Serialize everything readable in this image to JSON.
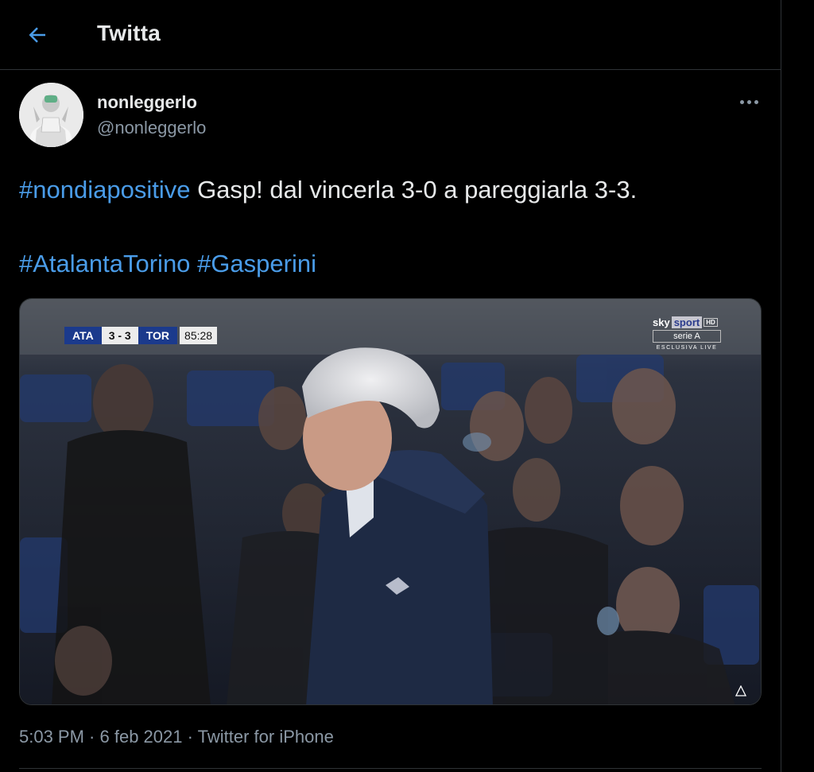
{
  "header": {
    "title": "Twitta",
    "back_icon": "arrow-left-icon"
  },
  "author": {
    "display_name": "nonleggerlo",
    "handle": "@nonleggerlo"
  },
  "tweet": {
    "line1_hashtag": "#nondiapositive",
    "line1_text": " Gasp! dal vincerla 3-0 a pareggiarla 3-3.",
    "line2_hashtag1": "#AtalantaTorino",
    "line2_space": " ",
    "line2_hashtag2": "#Gasperini"
  },
  "media": {
    "scorebug": {
      "home": "ATA",
      "score": "3 - 3",
      "away": "TOR",
      "clock": "85:28"
    },
    "broadcaster": {
      "brand_sky": "sky",
      "brand_sport": "sport",
      "brand_hd": "HD",
      "competition": "serie A",
      "live_label": "ESCLUSIVA LIVE"
    }
  },
  "meta": {
    "time": "5:03 PM",
    "separator1": " · ",
    "date": "6 feb 2021",
    "separator2": " · ",
    "source": "Twitter for iPhone"
  },
  "colors": {
    "background": "#000000",
    "text": "#e7e9ea",
    "secondary": "#8b98a5",
    "link": "#4a9ce8",
    "border": "#2f3336"
  }
}
